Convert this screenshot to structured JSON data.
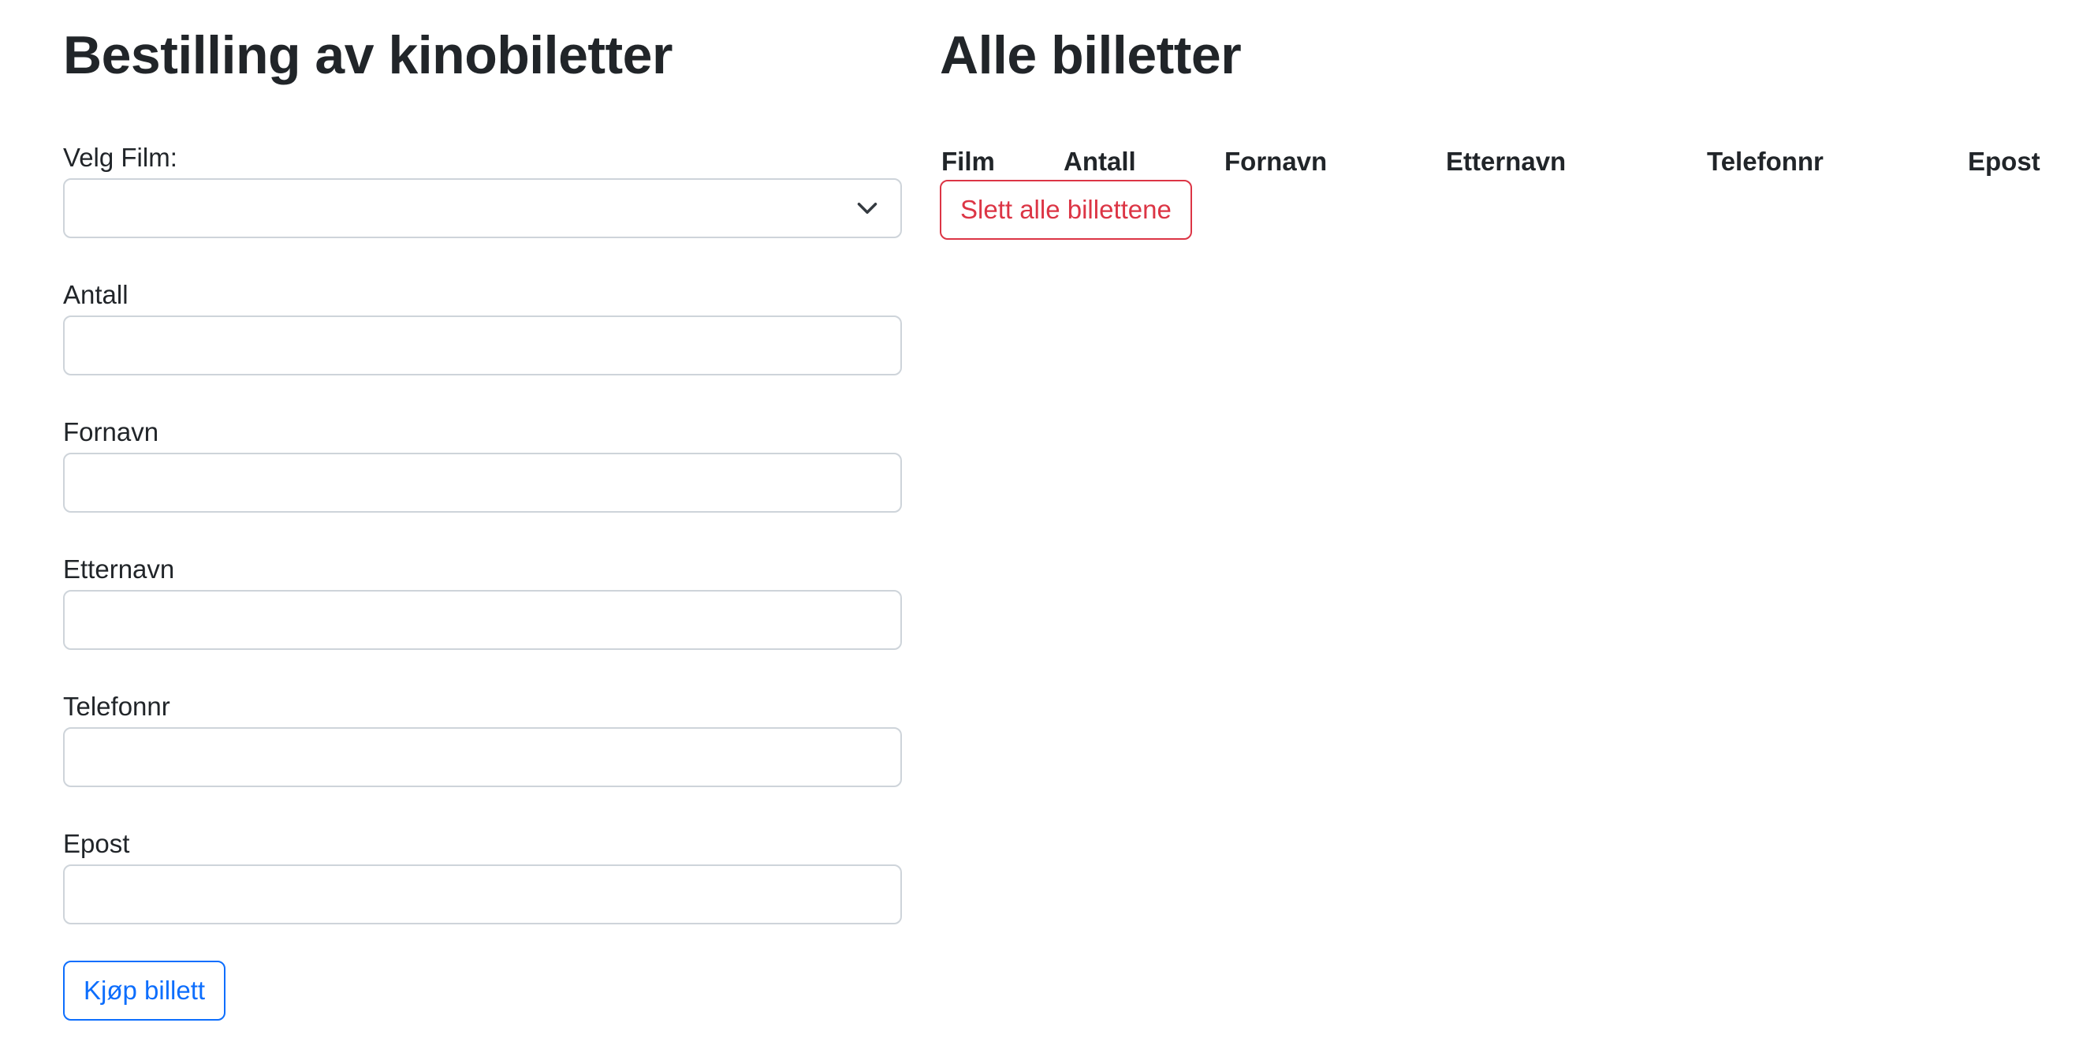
{
  "order_form": {
    "title": "Bestilling av kinobiletter",
    "film_label": "Velg Film:",
    "film_selected": "",
    "antall_label": "Antall",
    "antall_value": "",
    "fornavn_label": "Fornavn",
    "fornavn_value": "",
    "etternavn_label": "Etternavn",
    "etternavn_value": "",
    "telefonnr_label": "Telefonnr",
    "telefonnr_value": "",
    "epost_label": "Epost",
    "epost_value": "",
    "buy_button": "Kjøp billett",
    "icons": {
      "select": "chevron-down-icon"
    }
  },
  "tickets": {
    "title": "Alle billetter",
    "columns": [
      "Film",
      "Antall",
      "Fornavn",
      "Etternavn",
      "Telefonnr",
      "Epost"
    ],
    "rows": [],
    "delete_all_button": "Slett alle billettene"
  },
  "colors": {
    "primary": "#0d6efd",
    "danger": "#dc3545",
    "text": "#212529",
    "border": "#ced4da"
  }
}
